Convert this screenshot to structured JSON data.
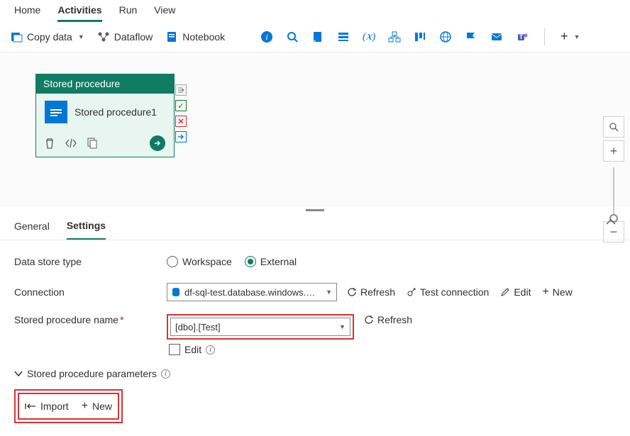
{
  "tabs": {
    "home": "Home",
    "activities": "Activities",
    "run": "Run",
    "view": "View"
  },
  "toolbar": {
    "copy": "Copy data",
    "dataflow": "Dataflow",
    "notebook": "Notebook"
  },
  "activity": {
    "type": "Stored procedure",
    "name": "Stored procedure1"
  },
  "panelTabs": {
    "general": "General",
    "settings": "Settings"
  },
  "form": {
    "dataStoreType": "Data store type",
    "workspace": "Workspace",
    "external": "External",
    "connection": "Connection",
    "connectionValue": "df-sql-test.database.windows.net;tes...",
    "refresh": "Refresh",
    "testConn": "Test connection",
    "edit": "Edit",
    "new": "New",
    "spName": "Stored procedure name",
    "spValue": "[dbo].[Test]",
    "spParams": "Stored procedure parameters",
    "import": "Import"
  }
}
